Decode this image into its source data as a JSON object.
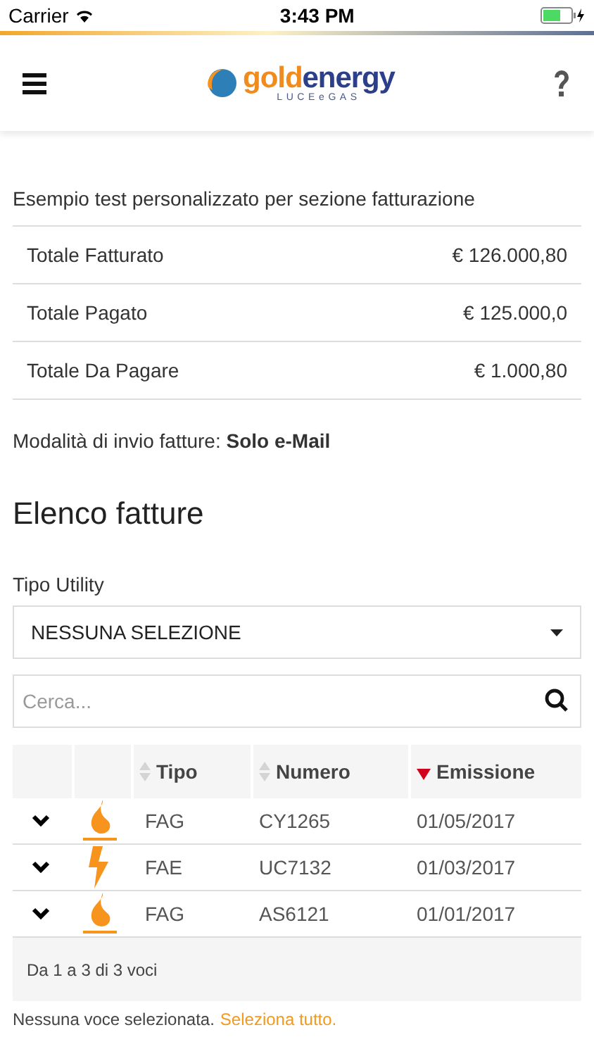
{
  "status_bar": {
    "carrier": "Carrier",
    "time": "3:43 PM"
  },
  "header": {
    "logo_parts": [
      "gold",
      "energy"
    ],
    "logo_tagline": "LUCEeGAS"
  },
  "intro": "Esempio test personalizzato per sezione fatturazione",
  "totals": [
    {
      "label": "Totale Fatturato",
      "value": "€ 126.000,80"
    },
    {
      "label": "Totale Pagato",
      "value": "€ 125.000,0"
    },
    {
      "label": "Totale Da Pagare",
      "value": "€ 1.000,80"
    }
  ],
  "delivery": "Modalità di invio fatture: **Solo e-Mail**",
  "section_title": "Elenco fatture",
  "filter": {
    "label": "Tipo Utility",
    "value": "NESSUNA SELEZIONE"
  },
  "search": {
    "placeholder": "Cerca..."
  },
  "table": {
    "columns": [
      {
        "label": "Tipo",
        "sorted": false
      },
      {
        "label": "Numero",
        "sorted": false
      },
      {
        "label": "Emissione",
        "sorted": true
      }
    ],
    "rows": [
      {
        "kind": "gas",
        "tipo": "FAG",
        "numero": "CY1265",
        "emissione": "01/05/2017"
      },
      {
        "kind": "electric",
        "tipo": "FAE",
        "numero": "UC7132",
        "emissione": "01/03/2017"
      },
      {
        "kind": "gas",
        "tipo": "FAG",
        "numero": "AS6121",
        "emissione": "01/01/2017"
      }
    ],
    "footer": "Da 1 a 3 di 3 voci"
  },
  "selection": {
    "text": "Nessuna voce selezionata.",
    "link": "Seleziona tutto."
  }
}
